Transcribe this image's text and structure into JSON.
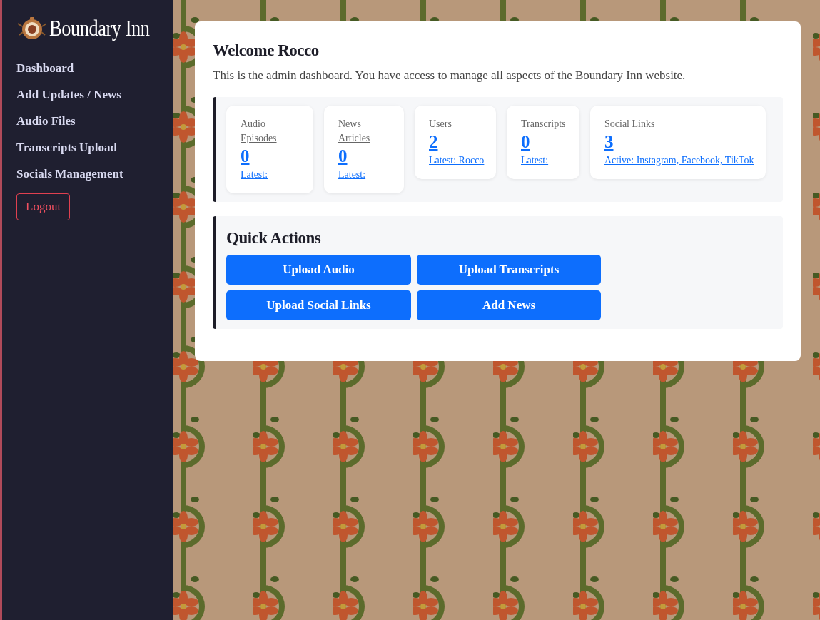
{
  "brand": {
    "name": "Boundary Inn"
  },
  "nav": [
    {
      "label": "Dashboard"
    },
    {
      "label": "Add Updates / News"
    },
    {
      "label": "Audio Files"
    },
    {
      "label": "Transcripts Upload"
    },
    {
      "label": "Socials Management"
    }
  ],
  "logout": {
    "label": "Logout"
  },
  "welcome": {
    "title": "Welcome Rocco",
    "text": "This is the admin dashboard. You have access to manage all aspects of the Boundary Inn website."
  },
  "stats": [
    {
      "label": "Audio Episodes",
      "value": "0",
      "latest": "Latest:"
    },
    {
      "label": "News Articles",
      "value": "0",
      "latest": "Latest:"
    },
    {
      "label": "Users",
      "value": "2",
      "latest": "Latest: Rocco"
    },
    {
      "label": "Transcripts",
      "value": "0",
      "latest": "Latest:"
    },
    {
      "label": "Social Links",
      "value": "3",
      "latest": "Active: Instagram, Facebook, TikTok"
    }
  ],
  "quick_actions": {
    "title": "Quick Actions",
    "buttons": [
      "Upload Audio",
      "Upload Transcripts",
      "Upload Social Links",
      "Add News"
    ]
  }
}
